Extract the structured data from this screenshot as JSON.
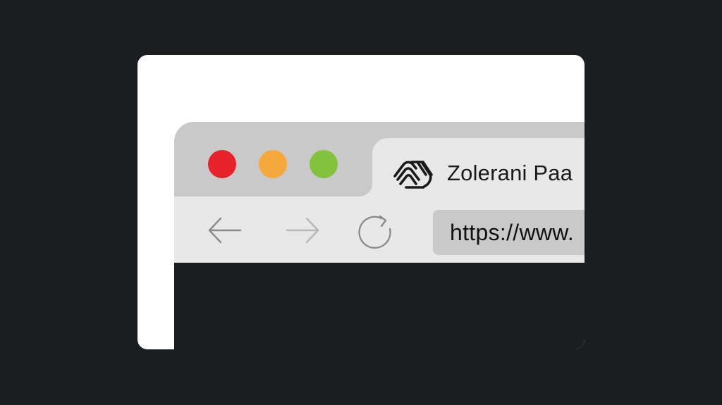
{
  "window": {
    "controls": {
      "close_color": "#e8222a",
      "minimize_color": "#f5a93c",
      "maximize_color": "#83c23d"
    }
  },
  "tab": {
    "title": "Zolerani Paa",
    "logo_icon": "wave-logo-icon"
  },
  "toolbar": {
    "back_icon": "arrow-left-icon",
    "forward_icon": "arrow-right-icon",
    "reload_icon": "reload-icon"
  },
  "address_bar": {
    "url": "https://www."
  },
  "colors": {
    "background": "#1c1d21",
    "card": "#ffffff",
    "chrome": "#c9c9c9",
    "toolbar": "#e8e8e8",
    "content": "#1c1d21"
  }
}
